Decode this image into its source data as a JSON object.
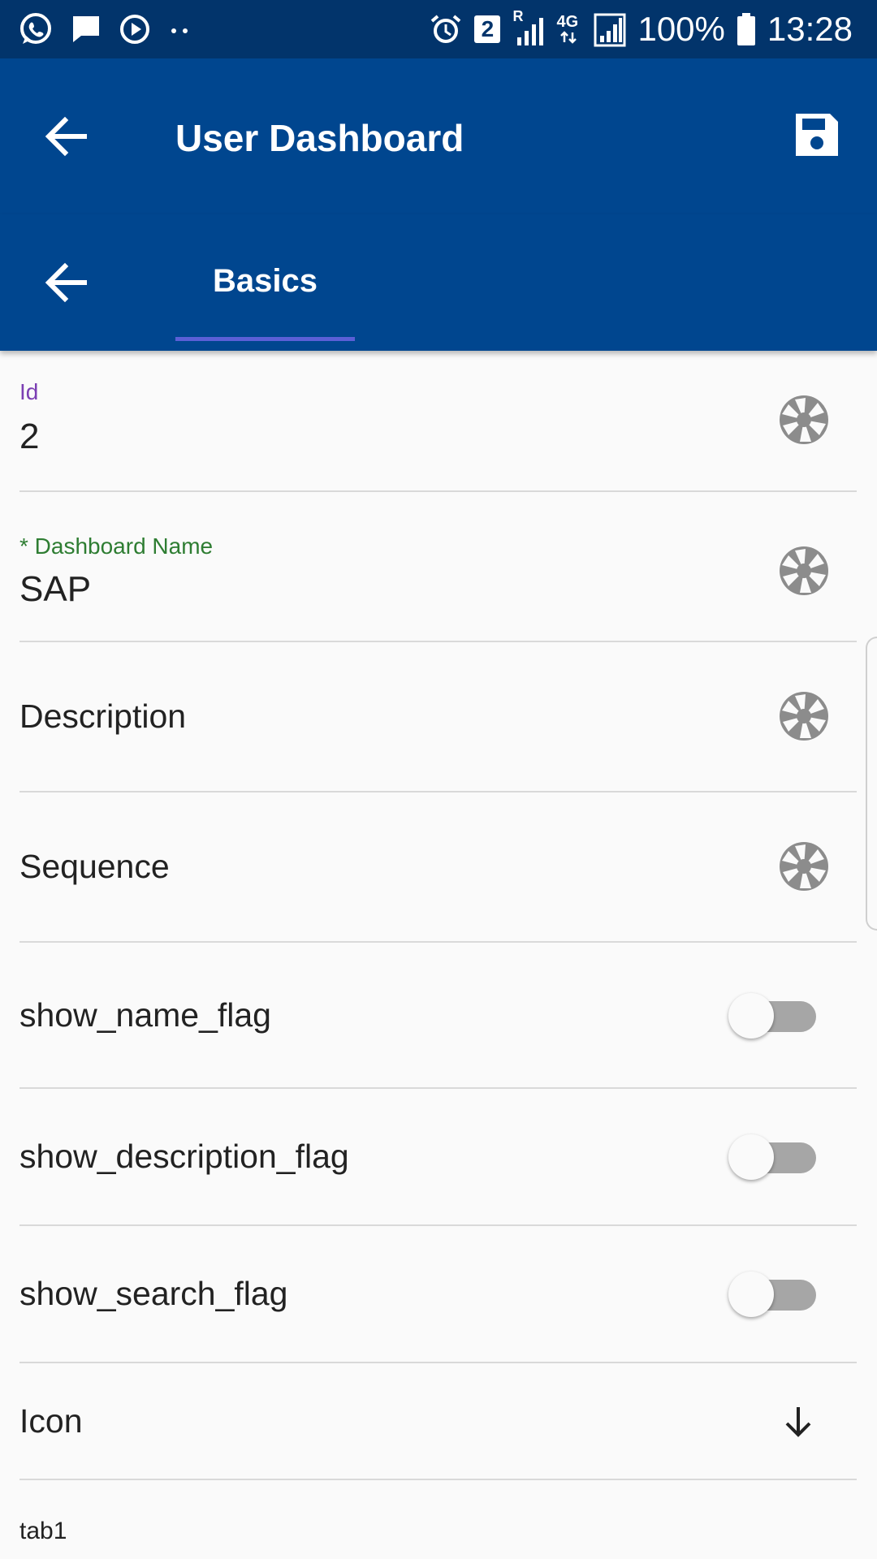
{
  "status_bar": {
    "sim_badge": "2",
    "network_r": "R",
    "network_type": "4G",
    "battery": "100%",
    "time": "13:28"
  },
  "app_bar": {
    "title": "User Dashboard",
    "back_icon": "arrow-left-icon",
    "save_icon": "floppy-disk-icon"
  },
  "tab_bar": {
    "back_icon": "arrow-left-icon",
    "tabs": [
      {
        "label": "Basics",
        "selected": true
      }
    ]
  },
  "form": {
    "id": {
      "label": "Id",
      "value": "2",
      "label_color": "#7b3fb3"
    },
    "dashboard_name": {
      "label": "* Dashboard Name",
      "value": "SAP",
      "label_color": "#2e7d32"
    },
    "description": {
      "label": "Description"
    },
    "sequence": {
      "label": "Sequence"
    },
    "show_name_flag": {
      "label": "show_name_flag",
      "checked": false
    },
    "show_description_flag": {
      "label": "show_description_flag",
      "checked": false
    },
    "show_search_flag": {
      "label": "show_search_flag",
      "checked": false
    },
    "icon": {
      "label": "Icon",
      "indicator_icon": "arrow-down-icon"
    },
    "next_section": "tab1"
  },
  "colors": {
    "status_bar": "#02346b",
    "app_bar": "#00468f",
    "tab_indicator": "#5b5fd6",
    "background": "#fafafa",
    "divider": "#d9d9d9"
  }
}
